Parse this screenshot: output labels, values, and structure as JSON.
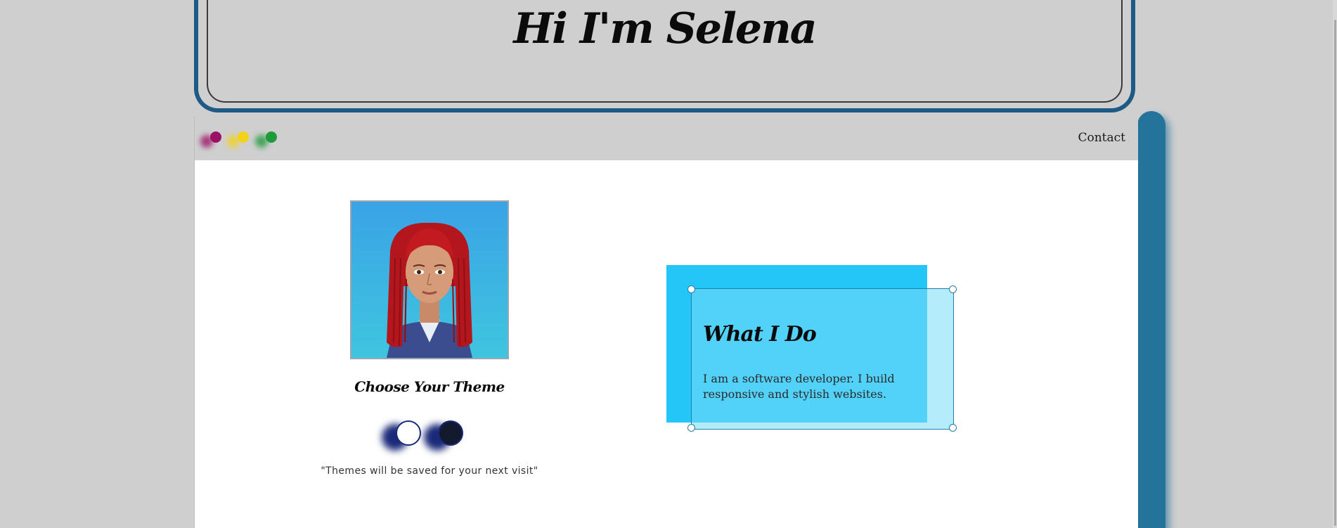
{
  "header": {
    "title": "Hi I'm Selena"
  },
  "nav": {
    "dots": [
      {
        "name": "magenta",
        "color": "#9b1166"
      },
      {
        "name": "yellow",
        "color": "#f2d31a"
      },
      {
        "name": "green",
        "color": "#1d9a3a"
      }
    ],
    "contact_label": "Contact"
  },
  "profile": {
    "avatar_icon": "avatar-illustration-red-braids"
  },
  "theme_picker": {
    "heading": "Choose Your Theme",
    "options": [
      {
        "name": "light",
        "color": "#ffffff"
      },
      {
        "name": "dark",
        "color": "#141a2e"
      }
    ],
    "note": "\"Themes will be saved for your next visit\""
  },
  "what_i_do": {
    "title": "What I Do",
    "body": "I am a software developer. I build responsive and stylish websites."
  },
  "colors": {
    "accent": "#1d5a85",
    "card_blue": "#24c6f7",
    "background": "#cfcfcf"
  }
}
